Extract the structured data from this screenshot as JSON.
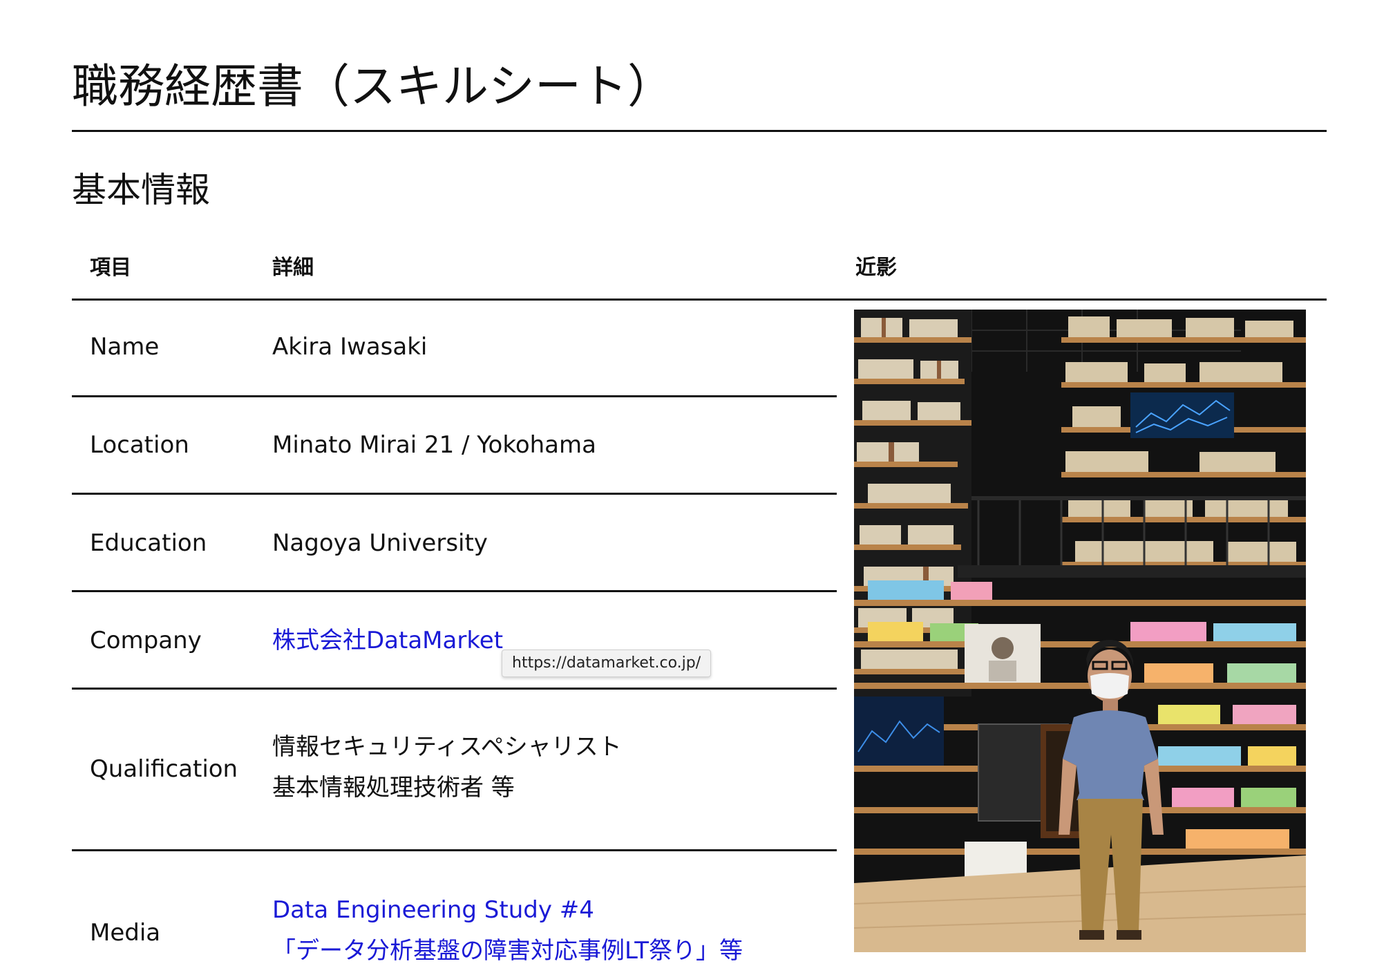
{
  "document": {
    "title": "職務経歴書（スキルシート）",
    "section_title": "基本情報"
  },
  "table": {
    "headers": {
      "item": "項目",
      "detail": "詳細",
      "photo": "近影"
    },
    "rows": {
      "name": {
        "label": "Name",
        "value": "Akira Iwasaki"
      },
      "location": {
        "label": "Location",
        "value": "Minato Mirai 21 / Yokohama"
      },
      "education": {
        "label": "Education",
        "value": "Nagoya University"
      },
      "company": {
        "label": "Company",
        "value": "株式会社DataMarket"
      },
      "qualification": {
        "label": "Qualification",
        "lines": [
          "情報セキュリティスペシャリスト",
          "基本情報処理技術者 等"
        ]
      },
      "media": {
        "label": "Media",
        "lines": [
          "Data Engineering Study #4",
          "「データ分析基盤の障害対応事例LT祭り」等"
        ]
      }
    }
  },
  "tooltip": {
    "text": "https://datamarket.co.jp/"
  },
  "photo": {
    "icon": "portrait-photo",
    "colors": {
      "background": "#121212",
      "shelf_wood": "#b9834a",
      "floor": "#d8b98e",
      "shirt": "#6f86b3",
      "trousers": "#a88445",
      "screen": "#1f5fa8"
    }
  },
  "colors": {
    "link": "#1a1ad6",
    "rule": "#111111",
    "text": "#111111"
  }
}
